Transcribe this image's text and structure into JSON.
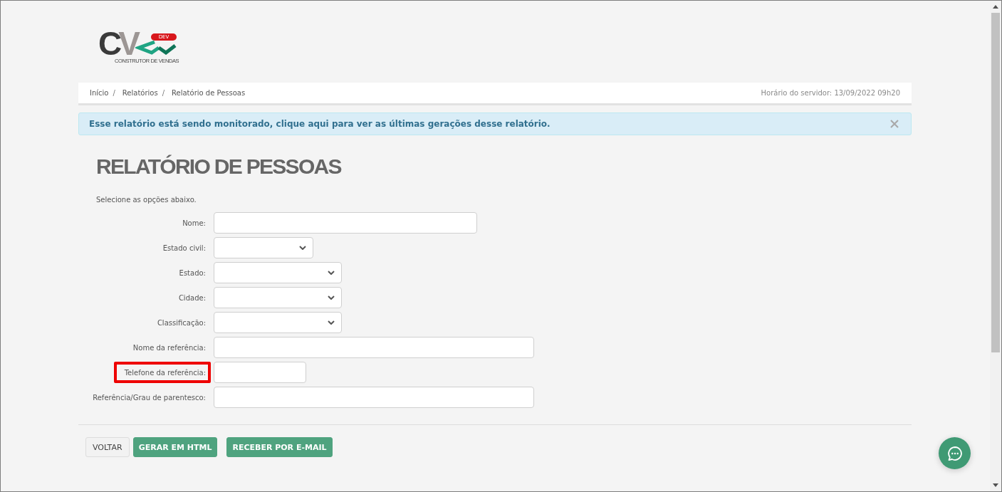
{
  "logo": {
    "letters": "CV",
    "badge": "DEV",
    "tagline": "CONSTRUTOR DE VENDAS"
  },
  "breadcrumb": {
    "separator": "/",
    "items": [
      "Início",
      "Relatórios",
      "Relatório de Pessoas"
    ]
  },
  "server_time": "Horário do servidor: 13/09/2022 09h20",
  "alert": {
    "text": "Esse relatório está sendo monitorado, clique aqui para ver as últimas gerações desse relatório."
  },
  "title": "RELATÓRIO DE PESSOAS",
  "instructions": "Selecione as opções abaixo.",
  "fields": [
    {
      "label": "Nome:",
      "kind": "text",
      "highlighted": false
    },
    {
      "label": "Estado civil:",
      "kind": "select",
      "highlighted": false
    },
    {
      "label": "Estado:",
      "kind": "select",
      "highlighted": false
    },
    {
      "label": "Cidade:",
      "kind": "select",
      "highlighted": false
    },
    {
      "label": "Classificação:",
      "kind": "select",
      "highlighted": false
    },
    {
      "label": "Nome da referência:",
      "kind": "text",
      "highlighted": false
    },
    {
      "label": "Telefone da referência:",
      "kind": "text",
      "highlighted": true
    },
    {
      "label": "Referência/Grau de parentesco:",
      "kind": "text",
      "highlighted": false
    }
  ],
  "buttons": [
    {
      "label": "VOLTAR",
      "kind": "default"
    },
    {
      "label": "GERAR EM HTML",
      "kind": "primary"
    },
    {
      "label": "RECEBER POR E-MAIL",
      "kind": "primary"
    }
  ]
}
